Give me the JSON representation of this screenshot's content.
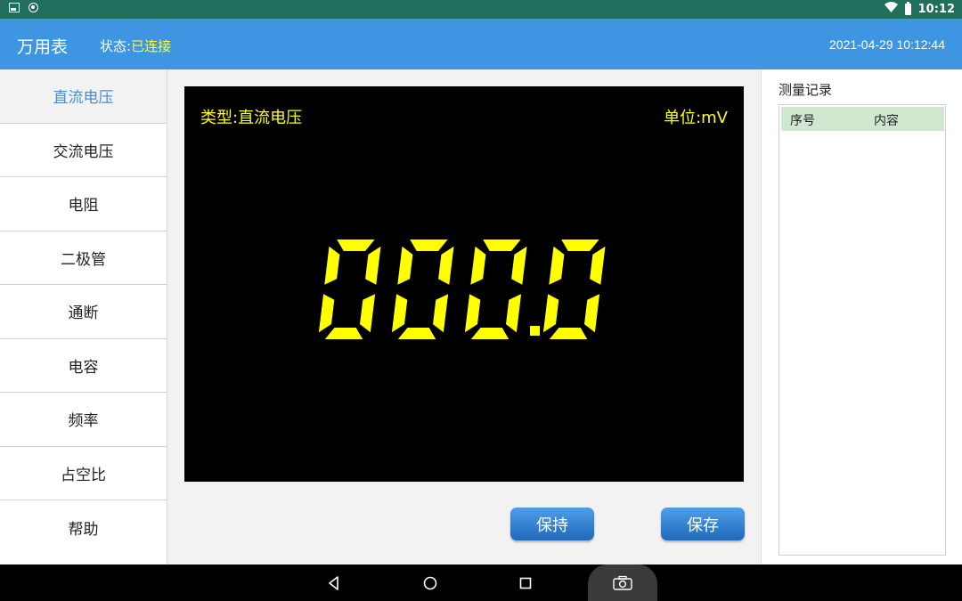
{
  "status_bar": {
    "time": "10:12",
    "icons": [
      "image-icon",
      "shield-icon",
      "wifi-icon",
      "battery-icon"
    ]
  },
  "header": {
    "title": "万用表",
    "status_label": "状态:",
    "status_value": "已连接",
    "datetime": "2021-04-29 10:12:44"
  },
  "sidebar": {
    "items": [
      {
        "label": "直流电压",
        "active": true
      },
      {
        "label": "交流电压"
      },
      {
        "label": "电阻"
      },
      {
        "label": "二极管"
      },
      {
        "label": "通断"
      },
      {
        "label": "电容"
      },
      {
        "label": "频率"
      },
      {
        "label": "占空比"
      },
      {
        "label": "帮助"
      }
    ]
  },
  "display": {
    "type_label": "类型:直流电压",
    "unit_label": "单位:mV",
    "reading": "000.0",
    "color": "#ffff00"
  },
  "buttons": {
    "hold": "保持",
    "save": "保存"
  },
  "records": {
    "title": "测量记录",
    "columns": [
      "序号",
      "内容"
    ],
    "rows": []
  },
  "nav": {
    "buttons": [
      "back-icon",
      "home-icon",
      "recents-icon",
      "camera-icon"
    ]
  },
  "colors": {
    "status_bar": "#1f6f5c",
    "header": "#3e95e2",
    "active_item": "#3e8fe0",
    "status_connected": "#ffff33",
    "table_header": "#cfe8cf"
  }
}
